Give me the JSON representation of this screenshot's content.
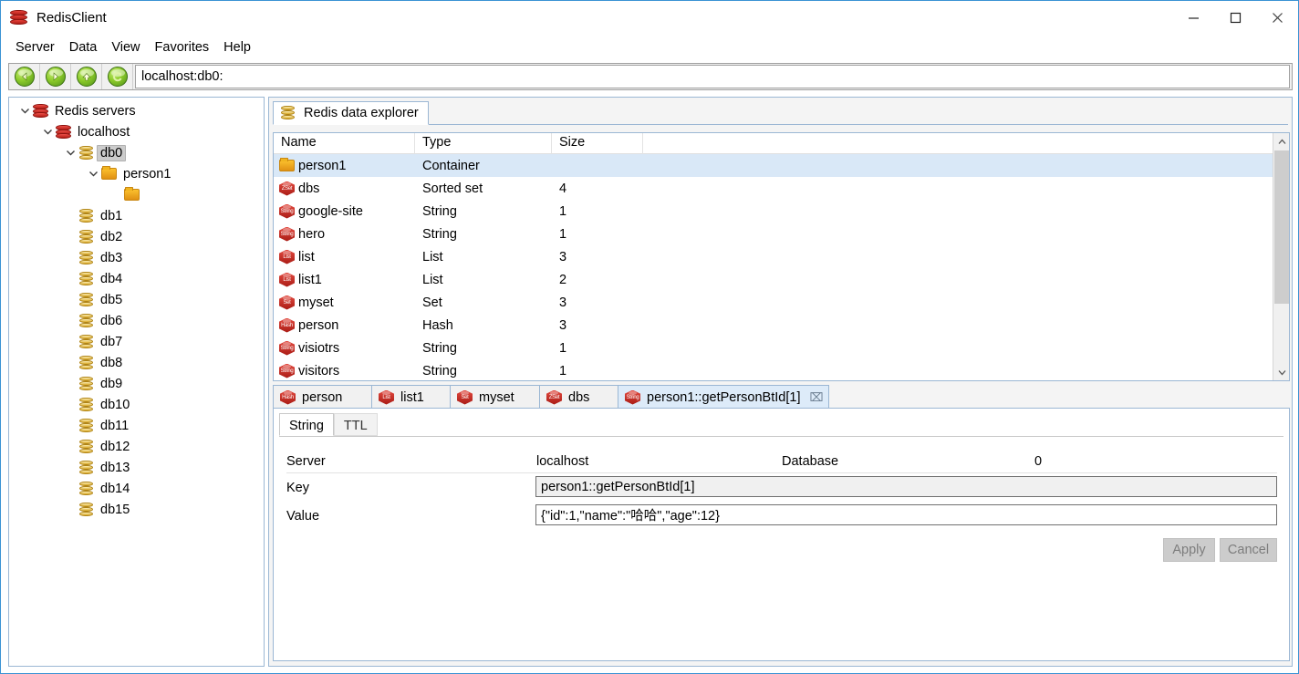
{
  "window": {
    "title": "RedisClient",
    "app_icon": "redis-logo-icon",
    "minimize": "─",
    "maximize": "□",
    "close": "✕"
  },
  "menubar": {
    "items": [
      "Server",
      "Data",
      "View",
      "Favorites",
      "Help"
    ]
  },
  "toolbar": {
    "buttons": [
      {
        "name": "back-button",
        "icon": "arrow-left-icon"
      },
      {
        "name": "forward-button",
        "icon": "arrow-right-icon"
      },
      {
        "name": "up-button",
        "icon": "arrow-up-icon"
      },
      {
        "name": "refresh-button",
        "icon": "refresh-icon"
      }
    ],
    "address": "localhost:db0:"
  },
  "tree": {
    "nodes": [
      {
        "label": "Redis servers",
        "icon": "redis-server-icon",
        "indent": 0,
        "twisty": "expanded",
        "selected": false
      },
      {
        "label": "localhost",
        "icon": "redis-server-icon",
        "indent": 1,
        "twisty": "expanded",
        "selected": false
      },
      {
        "label": "db0",
        "icon": "database-icon",
        "indent": 2,
        "twisty": "expanded",
        "selected": true
      },
      {
        "label": "person1",
        "icon": "folder-icon",
        "indent": 3,
        "twisty": "expanded",
        "selected": false
      },
      {
        "label": "",
        "icon": "folder-icon",
        "indent": 4,
        "twisty": "none",
        "selected": false
      },
      {
        "label": "db1",
        "icon": "database-icon",
        "indent": 2,
        "twisty": "none",
        "selected": false
      },
      {
        "label": "db2",
        "icon": "database-icon",
        "indent": 2,
        "twisty": "none",
        "selected": false
      },
      {
        "label": "db3",
        "icon": "database-icon",
        "indent": 2,
        "twisty": "none",
        "selected": false
      },
      {
        "label": "db4",
        "icon": "database-icon",
        "indent": 2,
        "twisty": "none",
        "selected": false
      },
      {
        "label": "db5",
        "icon": "database-icon",
        "indent": 2,
        "twisty": "none",
        "selected": false
      },
      {
        "label": "db6",
        "icon": "database-icon",
        "indent": 2,
        "twisty": "none",
        "selected": false
      },
      {
        "label": "db7",
        "icon": "database-icon",
        "indent": 2,
        "twisty": "none",
        "selected": false
      },
      {
        "label": "db8",
        "icon": "database-icon",
        "indent": 2,
        "twisty": "none",
        "selected": false
      },
      {
        "label": "db9",
        "icon": "database-icon",
        "indent": 2,
        "twisty": "none",
        "selected": false
      },
      {
        "label": "db10",
        "icon": "database-icon",
        "indent": 2,
        "twisty": "none",
        "selected": false
      },
      {
        "label": "db11",
        "icon": "database-icon",
        "indent": 2,
        "twisty": "none",
        "selected": false
      },
      {
        "label": "db12",
        "icon": "database-icon",
        "indent": 2,
        "twisty": "none",
        "selected": false
      },
      {
        "label": "db13",
        "icon": "database-icon",
        "indent": 2,
        "twisty": "none",
        "selected": false
      },
      {
        "label": "db14",
        "icon": "database-icon",
        "indent": 2,
        "twisty": "none",
        "selected": false
      },
      {
        "label": "db15",
        "icon": "database-icon",
        "indent": 2,
        "twisty": "none",
        "selected": false
      }
    ]
  },
  "explorer": {
    "tab_label": "Redis data explorer",
    "tab_icon": "database-icon",
    "columns": [
      "Name",
      "Type",
      "Size"
    ],
    "rows": [
      {
        "name": "person1",
        "type": "Container",
        "size": "",
        "icon": "folder-icon",
        "badge": "",
        "selected": true
      },
      {
        "name": "dbs",
        "type": "Sorted set",
        "size": "4",
        "icon": "zset-type-icon",
        "badge": "ZSet",
        "selected": false
      },
      {
        "name": "google-site",
        "type": "String",
        "size": "1",
        "icon": "string-type-icon",
        "badge": "String",
        "selected": false
      },
      {
        "name": "hero",
        "type": "String",
        "size": "1",
        "icon": "string-type-icon",
        "badge": "String",
        "selected": false
      },
      {
        "name": "list",
        "type": "List",
        "size": "3",
        "icon": "list-type-icon",
        "badge": "List",
        "selected": false
      },
      {
        "name": "list1",
        "type": "List",
        "size": "2",
        "icon": "list-type-icon",
        "badge": "List",
        "selected": false
      },
      {
        "name": "myset",
        "type": "Set",
        "size": "3",
        "icon": "set-type-icon",
        "badge": "Set",
        "selected": false
      },
      {
        "name": "person",
        "type": "Hash",
        "size": "3",
        "icon": "hash-type-icon",
        "badge": "Hash",
        "selected": false
      },
      {
        "name": "visiotrs",
        "type": "String",
        "size": "1",
        "icon": "string-type-icon",
        "badge": "String",
        "selected": false
      },
      {
        "name": "visitors",
        "type": "String",
        "size": "1",
        "icon": "string-type-icon",
        "badge": "String",
        "selected": false
      }
    ]
  },
  "value_tabs": [
    {
      "label": "person",
      "badge": "Hash",
      "active": false,
      "closable": false
    },
    {
      "label": "list1",
      "badge": "List",
      "active": false,
      "closable": false
    },
    {
      "label": "myset",
      "badge": "Set",
      "active": false,
      "closable": false
    },
    {
      "label": "dbs",
      "badge": "ZSet",
      "active": false,
      "closable": false
    },
    {
      "label": "person1::getPersonBtId[1]",
      "badge": "String",
      "active": true,
      "closable": true,
      "close_icon": "⌧"
    }
  ],
  "detail": {
    "sub_tabs": [
      {
        "label": "String",
        "active": true
      },
      {
        "label": "TTL",
        "active": false
      }
    ],
    "server_label": "Server",
    "server_value": "localhost",
    "database_label": "Database",
    "database_value": "0",
    "key_label": "Key",
    "key_value": "person1::getPersonBtId[1]",
    "value_label": "Value",
    "value_value": "{\"id\":1,\"name\":\"哈哈\",\"age\":12}",
    "apply_label": "Apply",
    "cancel_label": "Cancel"
  },
  "colors": {
    "window_border": "#3b93d4",
    "redis_red": "#c4221b",
    "selection_blue": "#d9e8f7",
    "tab_active": "#ddebf9",
    "panel_border": "#9bb7d4"
  }
}
